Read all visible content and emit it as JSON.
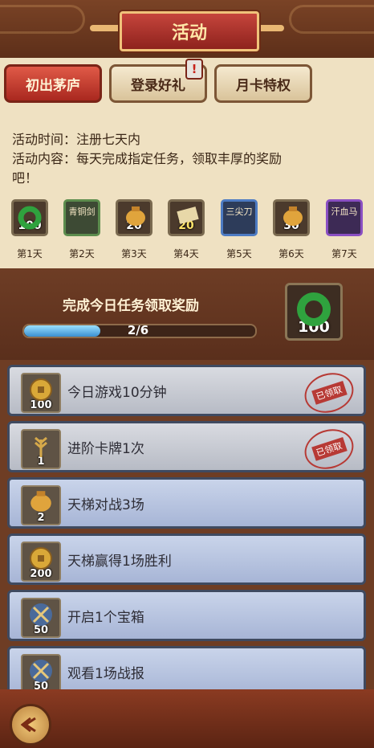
{
  "header": {
    "title": "活动"
  },
  "tabs": [
    {
      "label": "初出茅庐",
      "active": true
    },
    {
      "label": "登录好礼",
      "active": false,
      "badge": "!"
    },
    {
      "label": "月卡特权",
      "active": false
    }
  ],
  "info": {
    "time": "活动时间：注册七天内",
    "content_line1": "活动内容：每天完成指定任务，领取丰厚的奖励",
    "content_line2": "吧！"
  },
  "rewards": [
    {
      "day": "第1天",
      "num": "100",
      "name": "",
      "icon": "jade-ring-icon"
    },
    {
      "day": "第2天",
      "num": "",
      "name": "青铜剑",
      "icon": "bronze-sword-card"
    },
    {
      "day": "第3天",
      "num": "20",
      "name": "",
      "icon": "gold-pouch-icon"
    },
    {
      "day": "第4天",
      "num": "20",
      "name": "",
      "icon": "scroll-icon"
    },
    {
      "day": "第5天",
      "num": "",
      "name": "三尖刀",
      "icon": "trident-card"
    },
    {
      "day": "第6天",
      "num": "30",
      "name": "",
      "icon": "gold-pouch-icon"
    },
    {
      "day": "第7天",
      "num": "",
      "name": "汗血马",
      "icon": "horse-card"
    }
  ],
  "banner": {
    "text": "完成今日任务领取奖励",
    "progress_text": "2/6",
    "progress": 0.33,
    "reward_num": "100"
  },
  "tasks": [
    {
      "name": "今日游戏10分钟",
      "num": "100",
      "icon": "coin-icon",
      "claimed": true,
      "stamp": "已领取"
    },
    {
      "name": "进阶卡牌1次",
      "num": "1",
      "icon": "wheat-icon",
      "claimed": true,
      "stamp": "已领取"
    },
    {
      "name": "天梯对战3场",
      "num": "2",
      "icon": "gold-pouch-icon",
      "claimed": false
    },
    {
      "name": "天梯赢得1场胜利",
      "num": "200",
      "icon": "coin-icon",
      "claimed": false
    },
    {
      "name": "开启1个宝箱",
      "num": "50",
      "icon": "crossed-swords-icon",
      "claimed": false
    },
    {
      "name": "观看1场战报",
      "num": "50",
      "icon": "crossed-swords-icon",
      "claimed": false
    }
  ],
  "colors": {
    "accent_red": "#c6453c",
    "gold": "#f0c27a",
    "paper": "#efe1c2"
  }
}
